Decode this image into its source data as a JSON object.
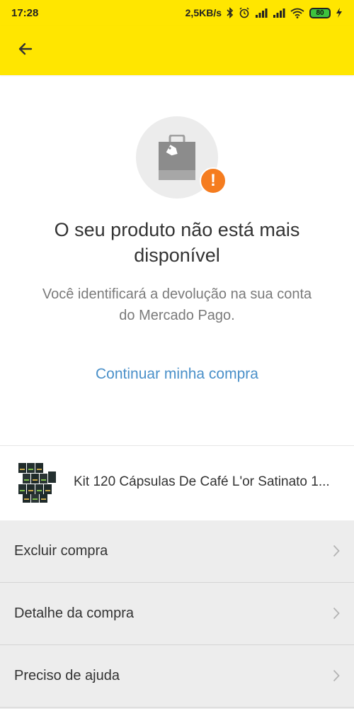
{
  "status_bar": {
    "time": "17:28",
    "network_speed": "2,5KB/s",
    "battery_level": "80"
  },
  "header": {
    "back_icon": "arrow-left-icon"
  },
  "empty_state": {
    "illustration_icon": "shopping-bag-icon",
    "badge_icon": "exclamation-icon",
    "badge_text": "!",
    "title": "O seu produto não está mais disponível",
    "subtitle": "Você identificará a devolução na sua conta do Mercado Pago.",
    "link_label": "Continuar minha compra"
  },
  "product": {
    "title": "Kit 120 Cápsulas De Café L'or Satinato 1..."
  },
  "actions": [
    {
      "label": "Excluir compra"
    },
    {
      "label": "Detalhe da compra"
    },
    {
      "label": "Preciso de ajuda"
    }
  ],
  "colors": {
    "brand_yellow": "#ffe600",
    "link_blue": "#4a90c9",
    "alert_orange": "#f57c1f"
  }
}
